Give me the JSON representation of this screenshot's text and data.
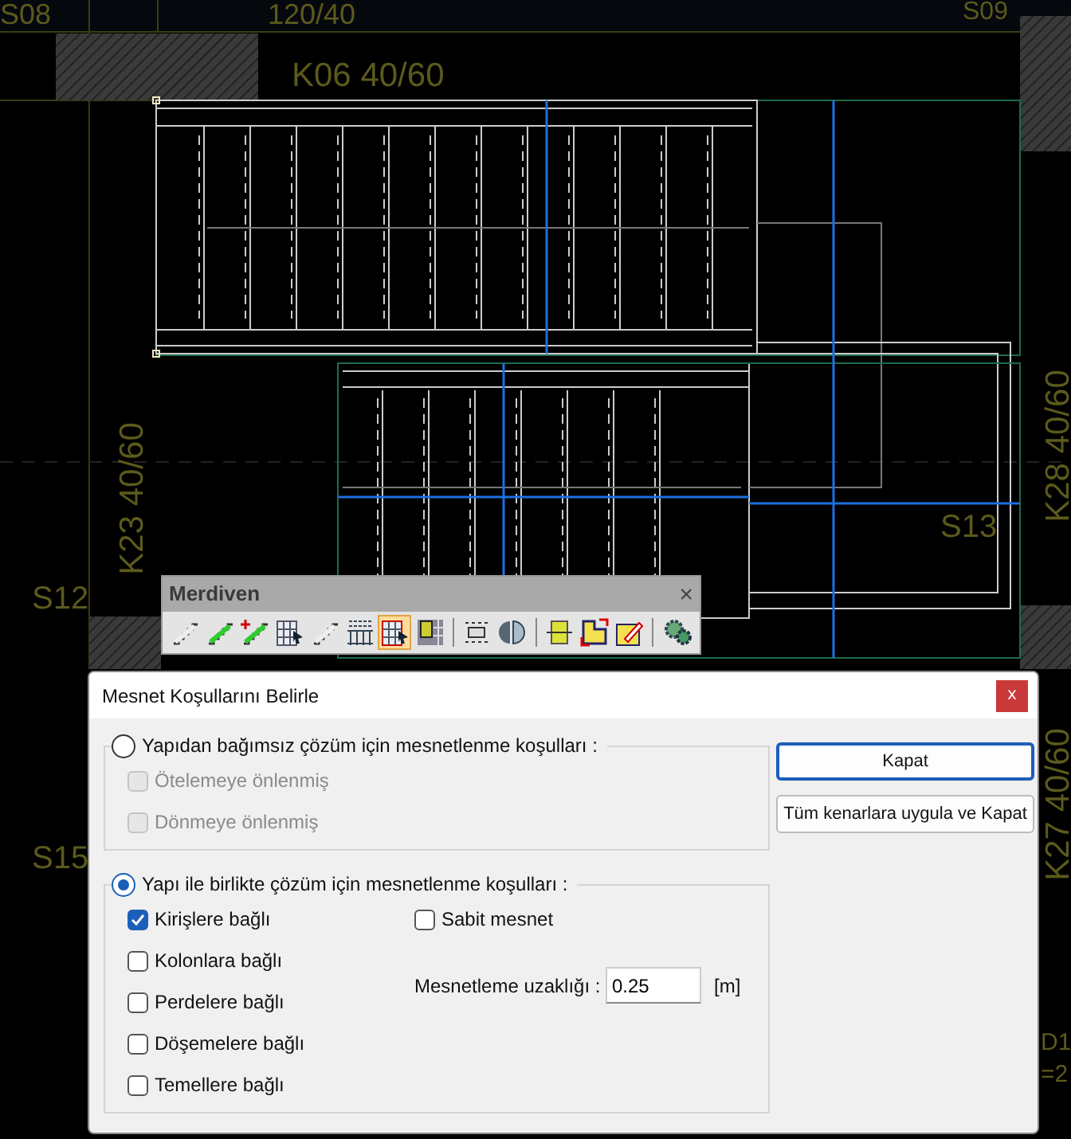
{
  "canvas": {
    "labels": [
      {
        "text": "S08",
        "kind": "horizontal"
      },
      {
        "text": "120/40",
        "kind": "horizontal"
      },
      {
        "text": "S09",
        "kind": "horizontal"
      },
      {
        "text": "K06 40/60",
        "kind": "horizontal"
      },
      {
        "text": "K23 40/60",
        "kind": "vertical"
      },
      {
        "text": "K28 40/60",
        "kind": "vertical"
      },
      {
        "text": "S13",
        "kind": "horizontal"
      },
      {
        "text": "S12",
        "kind": "horizontal"
      },
      {
        "text": "K27 40/60",
        "kind": "vertical"
      },
      {
        "text": "S15",
        "kind": "horizontal"
      },
      {
        "text": "D1",
        "kind": "horizontal"
      },
      {
        "text": "=2",
        "kind": "horizontal"
      }
    ]
  },
  "toolbar": {
    "title": "Merdiven",
    "close": "×",
    "groups": [
      [
        {
          "selected": false
        },
        {
          "selected": false
        },
        {
          "selected": false
        },
        {
          "selected": false
        },
        {
          "selected": false
        },
        {
          "selected": false
        },
        {
          "selected": true
        },
        {
          "selected": false
        }
      ],
      [
        {
          "selected": false
        },
        {
          "selected": false
        }
      ],
      [
        {
          "selected": false
        },
        {
          "selected": false
        },
        {
          "selected": false
        }
      ],
      [
        {
          "selected": false
        }
      ]
    ]
  },
  "dialog": {
    "title": "Mesnet Koşullarını Belirle",
    "close": "x",
    "groups": [
      {
        "label": "Yapıdan bağımsız çözüm için mesnetlenme koşulları  :",
        "selected": false,
        "checkboxes": [
          {
            "label": "Ötelemeye önlenmiş",
            "checked": false,
            "disabled": true
          },
          {
            "label": "Dönmeye önlenmiş",
            "checked": false,
            "disabled": true
          }
        ]
      },
      {
        "label": "Yapı ile birlikte çözüm için mesnetlenme koşulları  :",
        "selected": true,
        "checkboxes": [
          {
            "label": "Kirişlere bağlı",
            "checked": true,
            "disabled": false
          },
          {
            "label": "Kolonlara bağlı",
            "checked": false,
            "disabled": false
          },
          {
            "label": "Perdelere bağlı",
            "checked": false,
            "disabled": false
          },
          {
            "label": "Döşemelere bağlı",
            "checked": false,
            "disabled": false
          },
          {
            "label": "Temellere bağlı",
            "checked": false,
            "disabled": false
          }
        ],
        "extra_checkbox": {
          "label": "Sabit mesnet",
          "checked": false,
          "disabled": false
        },
        "field": {
          "label": "Mesnetleme uzaklığı :",
          "value": "0.25",
          "unit": "[m]"
        }
      }
    ],
    "buttons": [
      {
        "label": "Kapat",
        "kind": "default"
      },
      {
        "label": "Tüm kenarlara uygula ve Kapat",
        "kind": "normal"
      }
    ]
  }
}
